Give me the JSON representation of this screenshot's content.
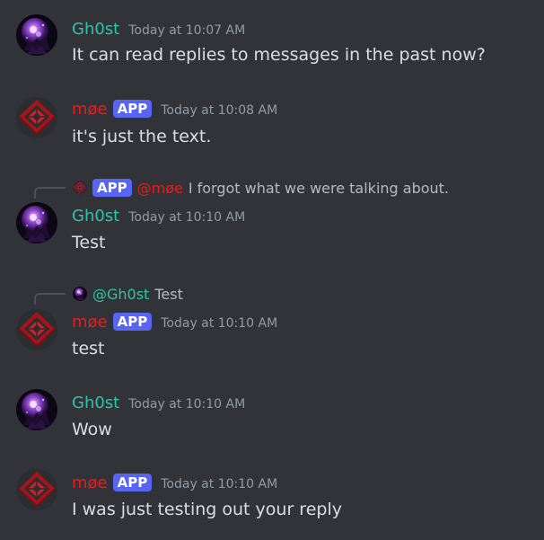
{
  "colors": {
    "background": "#313338",
    "ghost_name": "#2dc5a4",
    "moe_name": "#e11f1f",
    "app_tag": "#5865f2",
    "timestamp": "#949ba4",
    "text": "#dbdee1",
    "reply_text": "#b5bac1"
  },
  "messages": [
    {
      "author": "Gh0st",
      "timestamp": "Today at 10:07 AM",
      "text": "It can read replies to messages in the past now?"
    },
    {
      "author": "møe",
      "tag": "APP",
      "timestamp": "Today at 10:08 AM",
      "text": "it's just the text."
    },
    {
      "reply": {
        "tag": "APP",
        "mention": "@møe",
        "text": "I forgot what we were talking about."
      },
      "author": "Gh0st",
      "timestamp": "Today at 10:10 AM",
      "text": "Test"
    },
    {
      "reply": {
        "mention": "@Gh0st",
        "text": "Test"
      },
      "author": "møe",
      "tag": "APP",
      "timestamp": "Today at 10:10 AM",
      "text": "test"
    },
    {
      "author": "Gh0st",
      "timestamp": "Today at 10:10 AM",
      "text": "Wow"
    },
    {
      "author": "møe",
      "tag": "APP",
      "timestamp": "Today at 10:10 AM",
      "text": "I was just testing out your reply"
    }
  ]
}
